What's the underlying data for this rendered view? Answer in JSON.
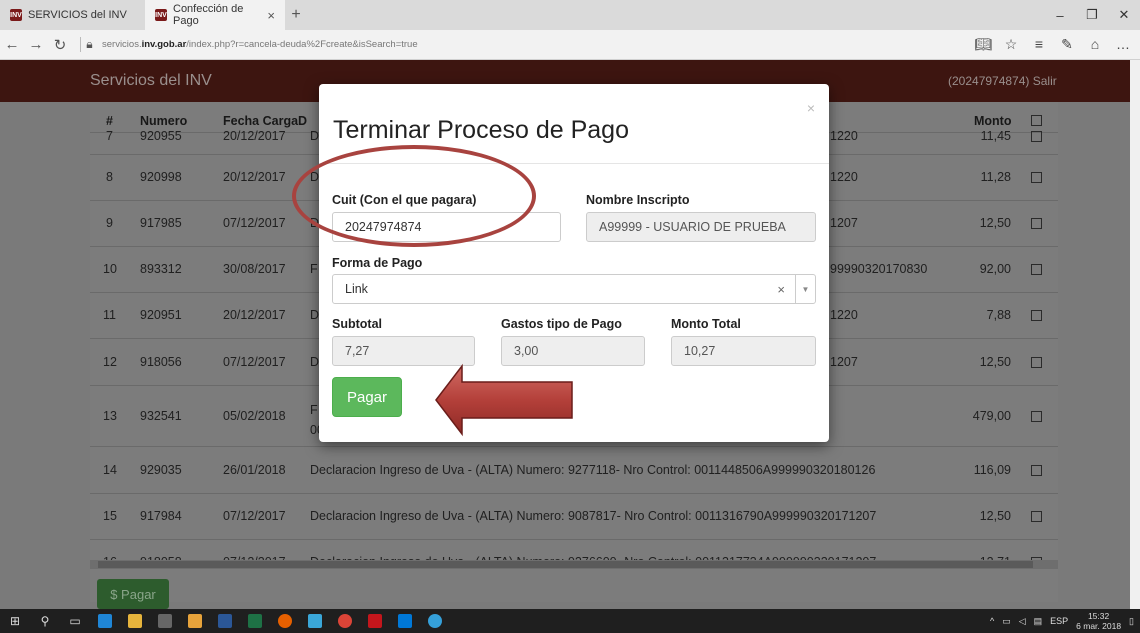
{
  "browser": {
    "tabs": [
      {
        "label": "SERVICIOS del INV",
        "active": false
      },
      {
        "label": "Confección de Pago",
        "active": true
      }
    ],
    "favicon_text": "INV",
    "new_tab": "+",
    "url_prefix": "servicios.",
    "url_domain": "inv.gob.ar",
    "url_suffix": "/index.php?r=cancela-deuda%2Fcreate&isSearch=true",
    "window_controls": {
      "minimize": "–",
      "restore": "❐",
      "close": "✕"
    }
  },
  "site": {
    "brand": "Servicios del INV",
    "user": "(20247974874) Salir"
  },
  "table": {
    "headers": {
      "num": "#",
      "numero": "Numero",
      "fecha": "Fecha Carga",
      "desc": "D",
      "monto": "Monto"
    },
    "rows": [
      {
        "num": "7",
        "numero": "920955",
        "fecha": "20/12/2017",
        "desc": "D",
        "desc_tail": "1220",
        "monto": "11,45"
      },
      {
        "num": "8",
        "numero": "920998",
        "fecha": "20/12/2017",
        "desc": "D",
        "desc_tail": "1220",
        "monto": "11,28"
      },
      {
        "num": "9",
        "numero": "917985",
        "fecha": "07/12/2017",
        "desc": "D",
        "desc_tail": "1207",
        "monto": "12,50"
      },
      {
        "num": "10",
        "numero": "893312",
        "fecha": "30/08/2017",
        "desc": "F",
        "desc_tail": "99990320170830",
        "monto": "92,00"
      },
      {
        "num": "11",
        "numero": "920951",
        "fecha": "20/12/2017",
        "desc": "D",
        "desc_tail": "1220",
        "monto": "7,88"
      },
      {
        "num": "12",
        "numero": "918056",
        "fecha": "07/12/2017",
        "desc": "D",
        "desc_tail": "1207",
        "monto": "12,50"
      },
      {
        "num": "13",
        "numero": "932541",
        "fecha": "05/02/2018",
        "desc": "F",
        "desc2": "00",
        "desc_tail": "",
        "monto": "479,00"
      },
      {
        "num": "14",
        "numero": "929035",
        "fecha": "26/01/2018",
        "desc": "Declaracion Ingreso de Uva - (ALTA) Numero: 9277118- Nro Control: 0011448506A999990320180126",
        "desc_tail": "",
        "monto": "116,09"
      },
      {
        "num": "15",
        "numero": "917984",
        "fecha": "07/12/2017",
        "desc": "Declaracion Ingreso de Uva - (ALTA) Numero: 9087817- Nro Control: 0011316790A999990320171207",
        "desc_tail": "",
        "monto": "12,50"
      },
      {
        "num": "16",
        "numero": "918058",
        "fecha": "07/12/2017",
        "desc": "Declaracion Ingreso de Uva - (ALTA) Numero: 9276600- Nro Control: 0011317734A999990320171207",
        "desc_tail": "",
        "monto": "12,71"
      }
    ],
    "pay_button": "$ Pagar"
  },
  "modal": {
    "title": "Terminar Proceso de Pago",
    "close": "×",
    "cuit_label": "Cuit (Con el que pagara)",
    "cuit_value": "20247974874",
    "nombre_label": "Nombre Inscripto",
    "nombre_value": "A99999 - USUARIO DE PRUEBA",
    "forma_label": "Forma de Pago",
    "forma_value": "Link",
    "subtotal_label": "Subtotal",
    "subtotal_value": "7,27",
    "gastos_label": "Gastos tipo de Pago",
    "gastos_value": "3,00",
    "total_label": "Monto Total",
    "total_value": "10,27",
    "pay_label": "Pagar"
  },
  "taskbar": {
    "lang": "ESP",
    "time": "15:32",
    "date": "6 mar. 2018"
  },
  "colors": {
    "navbar": "#3d1510",
    "pay_button": "#5cb85c",
    "annotation": "#a8433f"
  }
}
